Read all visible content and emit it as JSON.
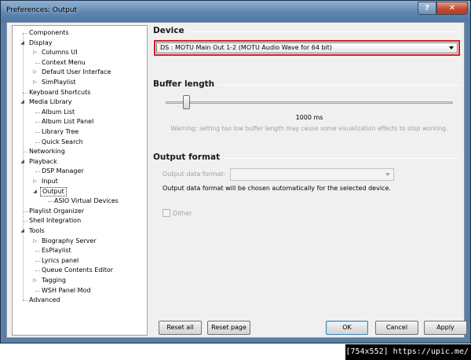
{
  "window": {
    "title": "Preferences: Output",
    "help_glyph": "?",
    "close_glyph": "✕"
  },
  "tree": {
    "items": [
      {
        "label": "Components",
        "level": 0,
        "expander": ""
      },
      {
        "label": "Display",
        "level": 0,
        "expander": "open"
      },
      {
        "label": "Columns UI",
        "level": 1,
        "expander": "closed"
      },
      {
        "label": "Context Menu",
        "level": 1,
        "expander": ""
      },
      {
        "label": "Default User Interface",
        "level": 1,
        "expander": "closed"
      },
      {
        "label": "SimPlaylist",
        "level": 1,
        "expander": "closed"
      },
      {
        "label": "Keyboard Shortcuts",
        "level": 0,
        "expander": ""
      },
      {
        "label": "Media Library",
        "level": 0,
        "expander": "open"
      },
      {
        "label": "Album List",
        "level": 1,
        "expander": ""
      },
      {
        "label": "Album List Panel",
        "level": 1,
        "expander": ""
      },
      {
        "label": "Library Tree",
        "level": 1,
        "expander": ""
      },
      {
        "label": "Quick Search",
        "level": 1,
        "expander": ""
      },
      {
        "label": "Networking",
        "level": 0,
        "expander": ""
      },
      {
        "label": "Playback",
        "level": 0,
        "expander": "open"
      },
      {
        "label": "DSP Manager",
        "level": 1,
        "expander": ""
      },
      {
        "label": "Input",
        "level": 1,
        "expander": "closed"
      },
      {
        "label": "Output",
        "level": 1,
        "expander": "open",
        "selected": true
      },
      {
        "label": "ASIO Virtual Devices",
        "level": 2,
        "expander": ""
      },
      {
        "label": "Playlist Organizer",
        "level": 0,
        "expander": ""
      },
      {
        "label": "Shell Integration",
        "level": 0,
        "expander": ""
      },
      {
        "label": "Tools",
        "level": 0,
        "expander": "open"
      },
      {
        "label": "Biography Server",
        "level": 1,
        "expander": "closed"
      },
      {
        "label": "EsPlaylist",
        "level": 1,
        "expander": ""
      },
      {
        "label": "Lyrics panel",
        "level": 1,
        "expander": ""
      },
      {
        "label": "Queue Contents Editor",
        "level": 1,
        "expander": ""
      },
      {
        "label": "Tagging",
        "level": 1,
        "expander": "closed"
      },
      {
        "label": "WSH Panel Mod",
        "level": 1,
        "expander": ""
      },
      {
        "label": "Advanced",
        "level": 0,
        "expander": ""
      }
    ]
  },
  "device": {
    "heading": "Device",
    "selected": "DS : MOTU Main Out 1-2 (MOTU Audio Wave for 64 bit)"
  },
  "buffer": {
    "heading": "Buffer length",
    "value_label": "1000 ms",
    "slider_fraction": 0.07,
    "warning": "Warning: setting too low buffer length may cause some visualization effects to stop working."
  },
  "output_format": {
    "heading": "Output format",
    "field_label": "Output data format:",
    "field_value": "",
    "note": "Output data format will be chosen automatically for the selected device.",
    "dither_label": "Dither",
    "dither_checked": false
  },
  "buttons": {
    "reset_all": "Reset all",
    "reset_page": "Reset page",
    "ok": "OK",
    "cancel": "Cancel",
    "apply": "Apply"
  },
  "watermark": "[754x552] https://upic.me/",
  "colors": {
    "highlight_border": "#d21f1f",
    "titlebar": "#5f86b1",
    "close_button": "#c24a32"
  }
}
